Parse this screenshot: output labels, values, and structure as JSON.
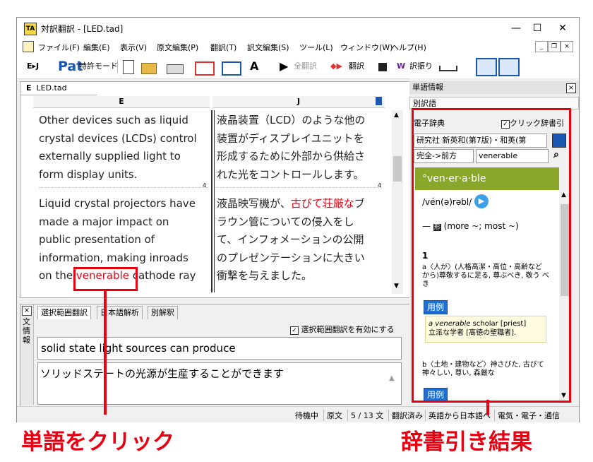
{
  "window": {
    "title": "対訳翻訳 - [LED.tad]",
    "controls": {
      "minimize": "—",
      "maximize": "☐",
      "close": "✕"
    }
  },
  "menu": {
    "items": [
      "ファイル(F)",
      "編集(E)",
      "表示(V)",
      "原文編集(P)",
      "翻訳(T)",
      "訳文編集(S)",
      "ツール(L)",
      "ウィンドウ(W)",
      "ヘルプ(H)"
    ],
    "mdi": {
      "minimize": "_",
      "restore": "❐",
      "close": "×"
    }
  },
  "toolbar": {
    "lang_pair": "E▸J",
    "pat_logo": "Pat",
    "patent_mode": "特許モード",
    "translate_all": "全翻訳",
    "translate": "翻訳",
    "wordswap": "訳振り"
  },
  "document": {
    "tab": "LED.tad",
    "tab_marker": "E",
    "col_e": "E",
    "col_j": "J",
    "en_para1": [
      "Other devices such as liquid",
      "crystal devices (LCDs) control",
      "externally supplied light to",
      "form display units."
    ],
    "en_para2_lines": [
      "Liquid crystal projectors have",
      "made a major impact on",
      "public presentation of",
      "information, making inroads"
    ],
    "en_para2_last_before": "on the ",
    "en_para2_highlight": "venerable",
    "en_para2_last_after": " cathode ray",
    "jp_para1": [
      "液晶装置（LCD）のような他の",
      "装置がディスプレイユニットを",
      "形成するために外部から供給さ",
      "れた光をコントロールします。"
    ],
    "jp_para2_first_before": "液晶映写機が、",
    "jp_para2_first_highlight": "古びて荘厳な",
    "jp_para2_first_after": "ブ",
    "jp_para2_rest": [
      "ラウン管についての侵入をし",
      "て、インフォメーションの公開",
      "のプレゼンテーションに大きい",
      "衝撃を与えました。"
    ],
    "para_marker": "4"
  },
  "bottom": {
    "close": "×",
    "side_label": "文情報",
    "tabs": [
      "選択範囲翻訳",
      "日本語解析",
      "別解釈"
    ],
    "enable_label": "選択範囲翻訳を有効にする",
    "source_text": "solid state light sources can produce",
    "target_text": "ソリッドステートの光源が生産することができます"
  },
  "status": [
    "待機中",
    "原文",
    "5 / 13 文",
    "翻訳済み",
    "英語から日本語へ",
    "電気・電子・通信"
  ],
  "sidebar": {
    "title": "単語情報",
    "close": "×",
    "alt_words": "別訳語",
    "dict_label": "電子辞典",
    "dict_check": "クリック辞書引",
    "dict_name": "研究社 新英和(第7版)・和英(第",
    "match_mode": "完全->前方",
    "query": "venerable",
    "headword": "°ven·er·a·ble",
    "pron": "/vén(ə)rəbl/",
    "pos": "形",
    "inflect": "(more ~; most ~)",
    "sense_no": "1",
    "sense_a": "a〈人が〉(人格高潔・高位・高齢など から)尊敬するに足る, 尊ぶべき, 敬う べき",
    "example_btn": "用例",
    "example_en_word": "a venerable",
    "example_en_rest": " scholar [priest]",
    "example_jp": "立派な学者 [高徳の聖職者].",
    "sense_b": "b〈土地・建物など〉神さびた, 古びて 神々しい, 尊い, 森厳な",
    "example_btn2": "用例"
  },
  "callouts": {
    "left": "単語をクリック",
    "right": "辞書引き結果"
  },
  "colors": {
    "accent_red": "#e60012",
    "dict_green": "#8aa72c",
    "example_blue": "#1e6fd0"
  }
}
